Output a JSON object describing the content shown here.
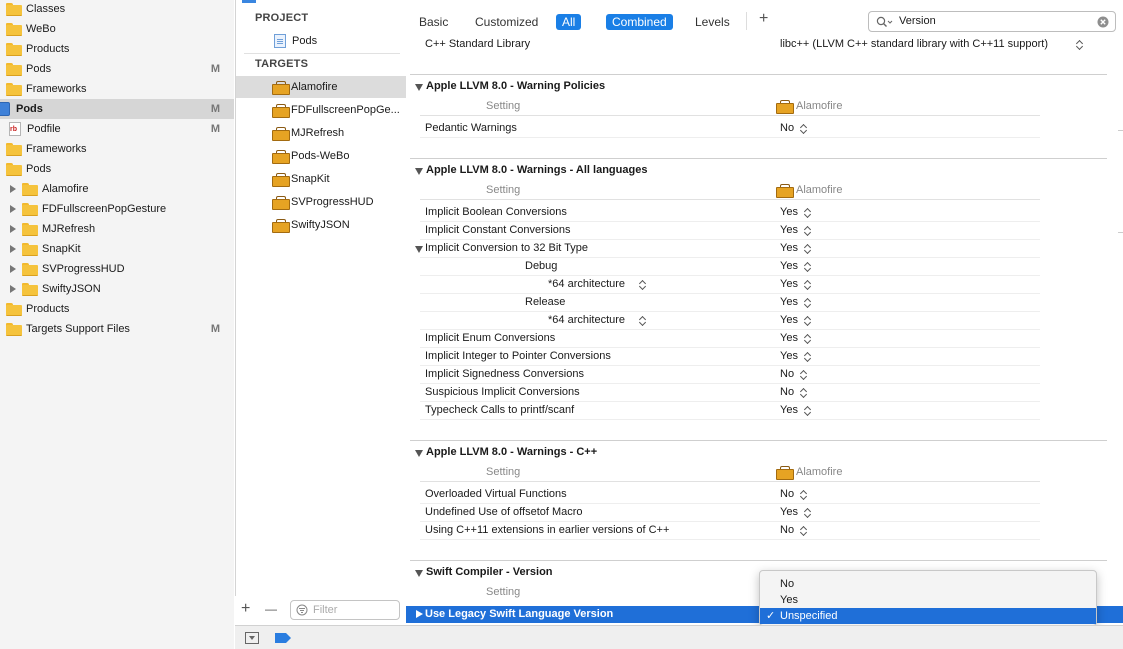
{
  "navigator": {
    "items": [
      {
        "label": "Classes",
        "icon": "folder-icon",
        "indent": 1,
        "disclosure": "none",
        "badge": ""
      },
      {
        "label": "WeBo",
        "icon": "folder-icon",
        "indent": 1,
        "disclosure": "none",
        "badge": ""
      },
      {
        "label": "Products",
        "icon": "folder-icon",
        "indent": 1,
        "disclosure": "none",
        "badge": ""
      },
      {
        "label": "Pods",
        "icon": "folder-icon",
        "indent": 1,
        "disclosure": "none",
        "badge": "M"
      },
      {
        "label": "Frameworks",
        "icon": "folder-icon",
        "indent": 1,
        "disclosure": "none",
        "badge": ""
      },
      {
        "label": "Pods",
        "icon": "project-icon",
        "indent": 0,
        "disclosure": "none",
        "badge": "M",
        "selected": true
      },
      {
        "label": "Podfile",
        "icon": "ruby-file-icon",
        "indent": 1,
        "disclosure": "none",
        "badge": "M"
      },
      {
        "label": "Frameworks",
        "icon": "folder-icon",
        "indent": 1,
        "disclosure": "none",
        "badge": ""
      },
      {
        "label": "Pods",
        "icon": "folder-icon",
        "indent": 1,
        "disclosure": "none",
        "badge": ""
      },
      {
        "label": "Alamofire",
        "icon": "folder-icon",
        "indent": 2,
        "disclosure": "collapsed",
        "badge": ""
      },
      {
        "label": "FDFullscreenPopGesture",
        "icon": "folder-icon",
        "indent": 2,
        "disclosure": "collapsed",
        "badge": ""
      },
      {
        "label": "MJRefresh",
        "icon": "folder-icon",
        "indent": 2,
        "disclosure": "collapsed",
        "badge": ""
      },
      {
        "label": "SnapKit",
        "icon": "folder-icon",
        "indent": 2,
        "disclosure": "collapsed",
        "badge": ""
      },
      {
        "label": "SVProgressHUD",
        "icon": "folder-icon",
        "indent": 2,
        "disclosure": "collapsed",
        "badge": ""
      },
      {
        "label": "SwiftyJSON",
        "icon": "folder-icon",
        "indent": 2,
        "disclosure": "collapsed",
        "badge": ""
      },
      {
        "label": "Products",
        "icon": "folder-icon",
        "indent": 1,
        "disclosure": "none",
        "badge": ""
      },
      {
        "label": "Targets Support Files",
        "icon": "folder-icon",
        "indent": 1,
        "disclosure": "none",
        "badge": "M"
      }
    ]
  },
  "targets_panel": {
    "project_header": "PROJECT",
    "project_item": "Pods",
    "targets_header": "TARGETS",
    "targets": [
      "Alamofire",
      "FDFullscreenPopGe...",
      "MJRefresh",
      "Pods-WeBo",
      "SnapKit",
      "SVProgressHUD",
      "SwiftyJSON"
    ],
    "selected_target": "Alamofire",
    "add_label": "+",
    "remove_label": "—",
    "filter_placeholder": "Filter"
  },
  "tabbar": {
    "basic": "Basic",
    "customized": "Customized",
    "all": "All",
    "combined": "Combined",
    "levels": "Levels",
    "add": "+",
    "search_value": "Version"
  },
  "settings": {
    "cpp_std_lib_label": "C++ Standard Library",
    "cpp_std_lib_value": "libc++ (LLVM C++ standard library with C++11 support)",
    "groups": [
      {
        "title": "Apple LLVM 8.0 - Warning Policies",
        "col_setting": "Setting",
        "col_target": "Alamofire",
        "rows": [
          {
            "label": "Pedantic Warnings",
            "value": "No"
          }
        ]
      },
      {
        "title": "Apple LLVM 8.0 - Warnings - All languages",
        "col_setting": "Setting",
        "col_target": "Alamofire",
        "rows": [
          {
            "label": "Implicit Boolean Conversions",
            "value": "Yes"
          },
          {
            "label": "Implicit Constant Conversions",
            "value": "Yes"
          },
          {
            "label": "Implicit Conversion to 32 Bit Type",
            "value": "Yes",
            "expanded": true
          },
          {
            "label": "Debug",
            "value": "Yes",
            "sub": 1
          },
          {
            "label": "*64 architecture",
            "value": "Yes",
            "sub": 2
          },
          {
            "label": "Release",
            "value": "Yes",
            "sub": 1
          },
          {
            "label": "*64 architecture",
            "value": "Yes",
            "sub": 2
          },
          {
            "label": "Implicit Enum Conversions",
            "value": "Yes"
          },
          {
            "label": "Implicit Integer to Pointer Conversions",
            "value": "Yes"
          },
          {
            "label": "Implicit Signedness Conversions",
            "value": "No"
          },
          {
            "label": "Suspicious Implicit Conversions",
            "value": "No"
          },
          {
            "label": "Typecheck Calls to printf/scanf",
            "value": "Yes"
          }
        ]
      },
      {
        "title": "Apple LLVM 8.0 - Warnings - C++",
        "col_setting": "Setting",
        "col_target": "Alamofire",
        "rows": [
          {
            "label": "Overloaded Virtual Functions",
            "value": "No"
          },
          {
            "label": "Undefined Use of offsetof Macro",
            "value": "Yes"
          },
          {
            "label": "Using C++11 extensions in earlier versions of C++",
            "value": "No"
          }
        ]
      }
    ],
    "swift_group_title": "Swift Compiler - Version",
    "swift_col_setting": "Setting",
    "legacy_row_label": "Use Legacy Swift Language Version"
  },
  "popup": {
    "options": [
      "No",
      "Yes",
      "Unspecified"
    ],
    "selected": "Unspecified",
    "check": "✓"
  },
  "colors": {
    "accent": "#1a7fe6",
    "selection": "#1f6fd8",
    "folder": "#f5c33c"
  }
}
